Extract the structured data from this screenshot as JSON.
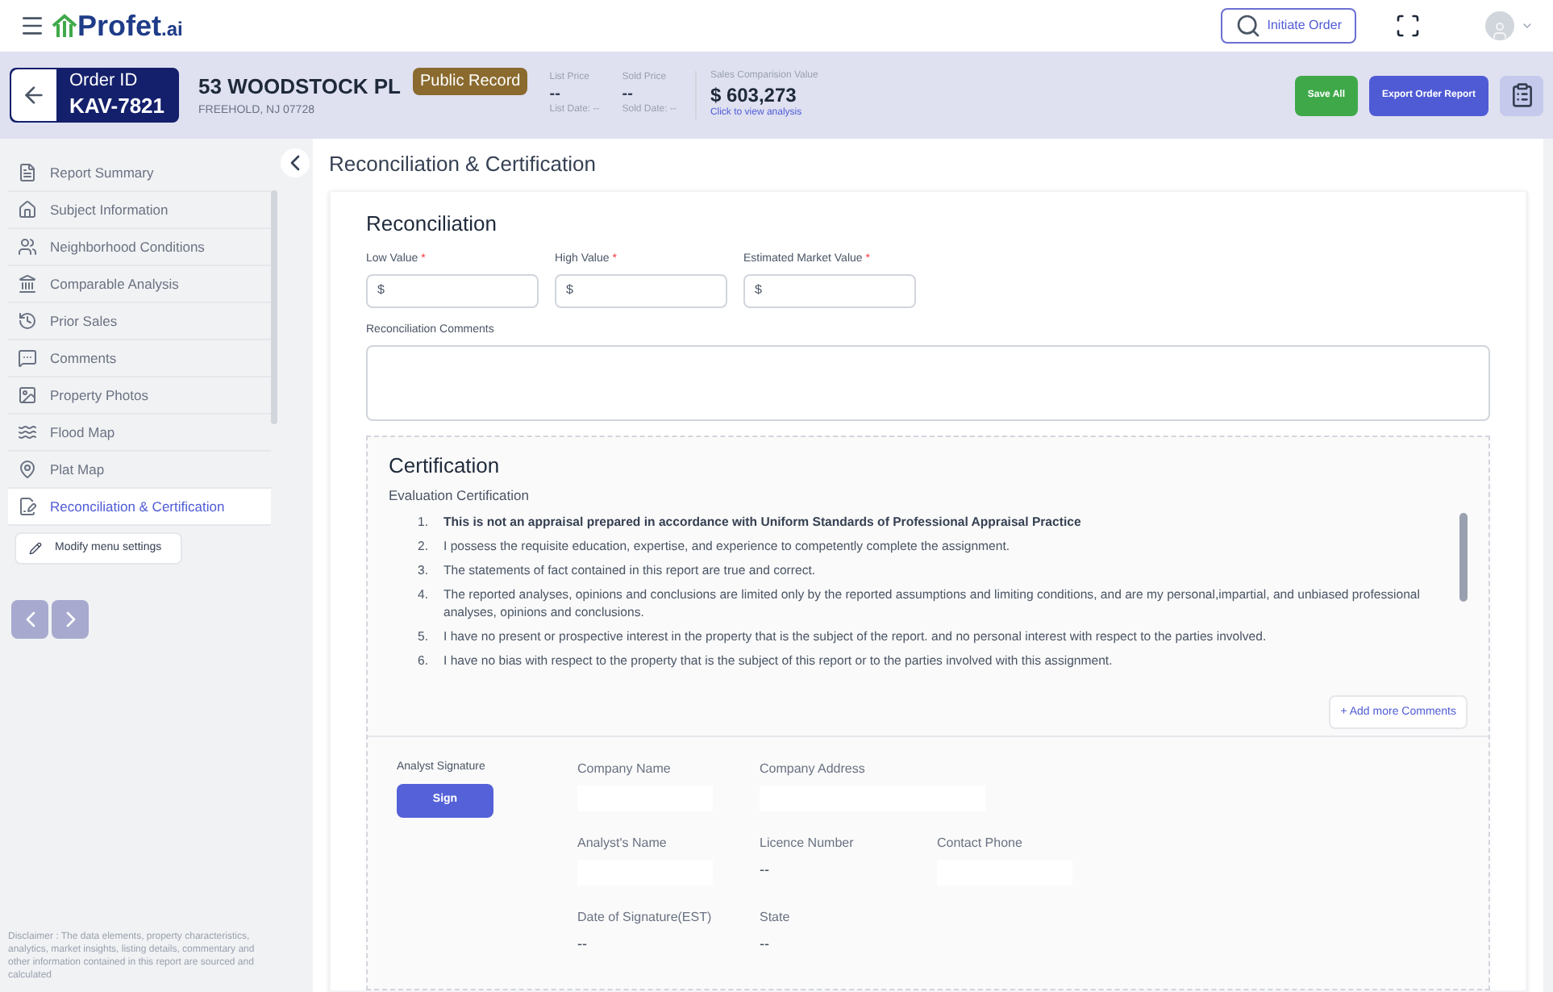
{
  "topbar": {
    "logo": "Profet",
    "logo_suffix": ".ai",
    "initiate_order": "Initiate Order"
  },
  "order": {
    "id_label": "Order ID",
    "id": "KAV-7821",
    "address": "53 WOODSTOCK PL",
    "city": "FREEHOLD, NJ 07728",
    "badge": "Public Record",
    "prices": [
      {
        "label": "List Price",
        "value": "--",
        "date": "List Date: --"
      },
      {
        "label": "Sold Price",
        "value": "--",
        "date": "Sold Date: --"
      }
    ],
    "comparison": {
      "label": "Sales Comparision Value",
      "value": "$ 603,273",
      "link": "Click to view analysis"
    },
    "buttons": [
      {
        "label": "Save All",
        "kind": "success"
      },
      {
        "label": "Export Order Report",
        "kind": "primary"
      }
    ]
  },
  "sidebar": {
    "items": [
      {
        "label": "Report Summary",
        "selected": false
      },
      {
        "label": "Subject Information",
        "selected": false
      },
      {
        "label": "Neighborhood Conditions",
        "selected": false
      },
      {
        "label": "Comparable Analysis",
        "selected": false
      },
      {
        "label": "Prior Sales",
        "selected": false
      },
      {
        "label": "Comments",
        "selected": false
      },
      {
        "label": "Property Photos",
        "selected": false
      },
      {
        "label": "Flood Map",
        "selected": false
      },
      {
        "label": "Plat Map",
        "selected": false
      },
      {
        "label": "Reconciliation & Certification",
        "selected": true
      }
    ],
    "modify": "Modify menu settings",
    "disclaimer": "Disclaimer : The data elements, property characteristics, analytics, market insights, listing details, commentary and other information contained in this report are sourced and calculated"
  },
  "main": {
    "title": "Reconciliation & Certification",
    "reconciliation": {
      "heading": "Reconciliation",
      "fields": [
        {
          "label": "Low Value",
          "required": true,
          "prefix": "$"
        },
        {
          "label": "High Value",
          "required": true,
          "prefix": "$"
        },
        {
          "label": "Estimated Market Value",
          "required": true,
          "prefix": "$"
        }
      ],
      "required_mark": "*",
      "comments_label": "Reconciliation Comments"
    },
    "certification": {
      "heading": "Certification",
      "subheading": "Evaluation Certification",
      "statements": [
        {
          "number": "1.",
          "text": "This is not an appraisal prepared in accordance with Uniform Standards of Professional Appraisal Practice",
          "bold": true
        },
        {
          "number": "2.",
          "text": "I possess the requisite education, expertise, and experience to competently complete the assignment.",
          "bold": false
        },
        {
          "number": "3.",
          "text": "The statements of fact contained in this report are true and correct.",
          "bold": false
        },
        {
          "number": "4.",
          "text": "The reported analyses, opinions and conclusions are limited only by the reported assumptions and limiting conditions, and are my personal,impartial, and unbiased professional analyses, opinions and conclusions.",
          "bold": false
        },
        {
          "number": "5.",
          "text": "I have no present or prospective interest in the property that is the subject of the report. and no personal interest with respect to the parties involved.",
          "bold": false
        },
        {
          "number": "6.",
          "text": "I have no bias with respect to the property that is the subject of this report or to the parties involved with this assignment.",
          "bold": false
        }
      ],
      "add_comments": "+ Add more Comments"
    },
    "signature": {
      "label": "Analyst Signature",
      "button": "Sign",
      "fields": [
        {
          "label": "Company Name",
          "kind": "input"
        },
        {
          "label": "Company Address",
          "kind": "input",
          "wide": true
        },
        {
          "label": "Analyst's Name",
          "kind": "input"
        },
        {
          "label": "Licence Number",
          "kind": "text",
          "value": "--"
        },
        {
          "label": "Contact Phone",
          "kind": "input"
        },
        {
          "label": "Date of Signature(EST)",
          "kind": "text",
          "value": "--"
        },
        {
          "label": "State",
          "kind": "text",
          "value": "--"
        }
      ]
    }
  }
}
